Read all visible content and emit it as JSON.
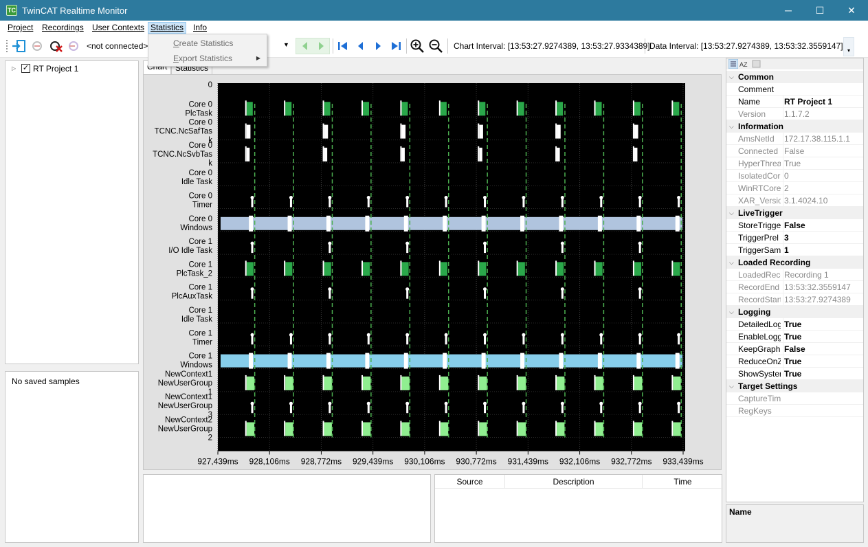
{
  "window": {
    "title": "TwinCAT Realtime Monitor",
    "icon": "twincat-app-icon",
    "minimize": "─",
    "maximize": "☐",
    "close": "✕"
  },
  "menu": {
    "items": [
      "Project",
      "Recordings",
      "User Contexts",
      "Statistics",
      "Info"
    ],
    "open_menu": {
      "items": [
        {
          "label": "Create Statistics",
          "mnemonic": "C",
          "rest": "reate Statistics",
          "submenu": false
        },
        {
          "label": "Export Statistics",
          "mnemonic": "E",
          "rest": "xport Statistics",
          "submenu": true
        }
      ]
    }
  },
  "toolbar": {
    "connection_text": "<not connected>",
    "chart_interval": "Chart Interval: [13:53:27.9274389, 13:53:27.9334389]",
    "data_interval": "Data Interval: [13:53:27.9274389, 13:53:32.3559147]",
    "icons": [
      "connect-icon",
      "disconnect-icon",
      "cancel-connection-icon",
      "remove-target-icon",
      "dropdown-arrow-icon",
      "scroll-left-green-icon",
      "scroll-right-green-icon",
      "go-first-icon",
      "go-previous-icon",
      "go-next-icon",
      "go-last-icon",
      "zoom-in-icon",
      "zoom-out-icon"
    ]
  },
  "tree": {
    "items": [
      {
        "label": "RT Project 1",
        "checked": true
      }
    ]
  },
  "samples": {
    "text": "No saved samples"
  },
  "tabs": [
    "Chart",
    "Statistics"
  ],
  "chart_data": {
    "type": "timeline",
    "x_axis": {
      "unit": "ms",
      "ticks": [
        "927,439ms",
        "928,106ms",
        "928,772ms",
        "929,439ms",
        "930,106ms",
        "930,772ms",
        "931,439ms",
        "932,106ms",
        "932,772ms",
        "933,439ms"
      ],
      "range": [
        927.439,
        933.439
      ]
    },
    "y_top_label": "0",
    "rows": [
      {
        "label": [
          "Core 0",
          "PlcTask"
        ],
        "kind": "pulse",
        "period_ms": 0.5,
        "width_ms": 0.08,
        "color": "#2aa84a"
      },
      {
        "label": [
          "Core 0",
          "TCNC.NcSafTas",
          "k"
        ],
        "kind": "pulse",
        "period_ms": 1.0,
        "width_ms": 0.05,
        "color": "#ffffff"
      },
      {
        "label": [
          "Core 0",
          "TCNC.NcSvbTas",
          "k"
        ],
        "kind": "pulse",
        "period_ms": 1.0,
        "width_ms": 0.04,
        "color": "#ffffff"
      },
      {
        "label": [
          "Core 0",
          "Idle Task"
        ],
        "kind": "empty",
        "color": "#000000"
      },
      {
        "label": [
          "Core 0",
          "Timer"
        ],
        "kind": "tick",
        "period_ms": 0.5,
        "color": "#ffffff"
      },
      {
        "label": [
          "Core 0",
          "Windows"
        ],
        "kind": "band",
        "color": "#b0c4de"
      },
      {
        "label": [
          "Core 1",
          "I/O Idle Task"
        ],
        "kind": "tick",
        "period_ms": 1.0,
        "color": "#ffffff"
      },
      {
        "label": [
          "Core 1",
          "PlcTask_2"
        ],
        "kind": "pulse",
        "period_ms": 0.5,
        "width_ms": 0.09,
        "color": "#2aa84a"
      },
      {
        "label": [
          "Core 1",
          "PlcAuxTask"
        ],
        "kind": "tick",
        "period_ms": 1.0,
        "color": "#ffffff"
      },
      {
        "label": [
          "Core 1",
          "Idle Task"
        ],
        "kind": "empty",
        "color": "#000000"
      },
      {
        "label": [
          "Core 1",
          "Timer"
        ],
        "kind": "tick",
        "period_ms": 0.5,
        "color": "#ffffff"
      },
      {
        "label": [
          "Core 1",
          "Windows"
        ],
        "kind": "band",
        "color": "#87ceeb"
      },
      {
        "label": [
          "NewContext1",
          "NewUserGroup",
          "1"
        ],
        "kind": "pulse",
        "period_ms": 0.5,
        "width_ms": 0.1,
        "color": "#90ee90"
      },
      {
        "label": [
          "NewContext1",
          "NewUserGroup",
          "3"
        ],
        "kind": "tick",
        "period_ms": 0.5,
        "color": "#ffffff"
      },
      {
        "label": [
          "NewContext2",
          "NewUserGroup",
          "2"
        ],
        "kind": "pulse",
        "period_ms": 0.5,
        "width_ms": 0.1,
        "color": "#90ee90"
      }
    ],
    "markers_color": "#4caf50",
    "grid": true,
    "background": "#000000"
  },
  "log": {
    "columns": [
      "Source",
      "Description",
      "Time"
    ]
  },
  "properties": {
    "categories": [
      {
        "name": "Common",
        "rows": [
          {
            "key": "Comment",
            "value": "",
            "dim": false,
            "bold": false
          },
          {
            "key": "Name",
            "value": "RT Project 1",
            "dim": false,
            "bold": true
          },
          {
            "key": "Version",
            "value": "1.1.7.2",
            "dim": true,
            "bold": false
          }
        ]
      },
      {
        "name": "Information",
        "rows": [
          {
            "key": "AmsNetId",
            "value": "172.17.38.115.1.1",
            "dim": true,
            "bold": false
          },
          {
            "key": "Connected",
            "value": "False",
            "dim": true,
            "bold": false
          },
          {
            "key": "HyperThrea",
            "value": "True",
            "dim": true,
            "bold": false
          },
          {
            "key": "IsolatedCor",
            "value": "0",
            "dim": true,
            "bold": false
          },
          {
            "key": "WinRTCores",
            "value": "2",
            "dim": true,
            "bold": false
          },
          {
            "key": "XAR_Versio",
            "value": "3.1.4024.10",
            "dim": true,
            "bold": false
          }
        ]
      },
      {
        "name": "LiveTrigger",
        "rows": [
          {
            "key": "StoreTrigge",
            "value": "False",
            "dim": false,
            "bold": true
          },
          {
            "key": "TriggerPrel",
            "value": "3",
            "dim": false,
            "bold": true
          },
          {
            "key": "TriggerSam",
            "value": "1",
            "dim": false,
            "bold": true
          }
        ]
      },
      {
        "name": "Loaded Recording",
        "rows": [
          {
            "key": "LoadedReco",
            "value": "Recording 1",
            "dim": true,
            "bold": false
          },
          {
            "key": "RecordEnd",
            "value": "13:53:32.3559147",
            "dim": true,
            "bold": false
          },
          {
            "key": "RecordStart",
            "value": "13:53:27.9274389",
            "dim": true,
            "bold": false
          }
        ]
      },
      {
        "name": "Logging",
        "rows": [
          {
            "key": "DetailedLog",
            "value": "True",
            "dim": false,
            "bold": true
          },
          {
            "key": "EnableLogg",
            "value": "True",
            "dim": false,
            "bold": true
          },
          {
            "key": "KeepGraph(",
            "value": "False",
            "dim": false,
            "bold": true
          },
          {
            "key": "ReduceOnZ",
            "value": "True",
            "dim": false,
            "bold": true
          },
          {
            "key": "ShowSyster",
            "value": "True",
            "dim": false,
            "bold": true
          }
        ]
      },
      {
        "name": "Target Settings",
        "rows": [
          {
            "key": "CaptureTim",
            "value": "",
            "dim": true,
            "bold": false
          },
          {
            "key": "RegKeys",
            "value": "",
            "dim": true,
            "bold": false
          }
        ]
      }
    ],
    "description_title": "Name"
  },
  "colors": {
    "titlebar": "#2d7a9e",
    "accent": "#2c85d6",
    "menu_open": "#cce4f7"
  }
}
